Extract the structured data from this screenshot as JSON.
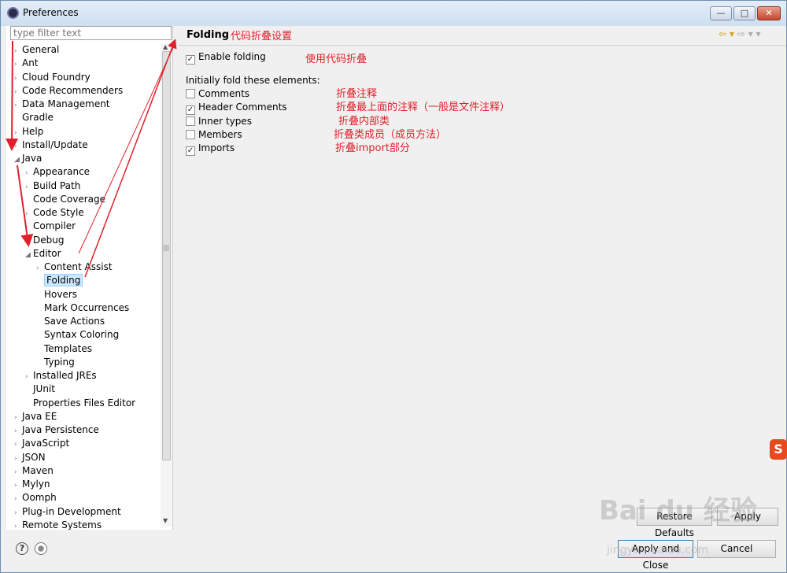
{
  "window": {
    "title": "Preferences",
    "minimize_glyph": "—",
    "maximize_glyph": "□",
    "close_glyph": "✕"
  },
  "filter": {
    "placeholder": "type filter text"
  },
  "tree": [
    {
      "label": "General",
      "level": 0,
      "expander": "›"
    },
    {
      "label": "Ant",
      "level": 0,
      "expander": "›"
    },
    {
      "label": "Cloud Foundry",
      "level": 0,
      "expander": "›"
    },
    {
      "label": "Code Recommenders",
      "level": 0,
      "expander": "›"
    },
    {
      "label": "Data Management",
      "level": 0,
      "expander": "›"
    },
    {
      "label": "Gradle",
      "level": 0,
      "expander": ""
    },
    {
      "label": "Help",
      "level": 0,
      "expander": "›"
    },
    {
      "label": "Install/Update",
      "level": 0,
      "expander": "›"
    },
    {
      "label": "Java",
      "level": 0,
      "expander": "◢"
    },
    {
      "label": "Appearance",
      "level": 1,
      "expander": "›"
    },
    {
      "label": "Build Path",
      "level": 1,
      "expander": "›"
    },
    {
      "label": "Code Coverage",
      "level": 1,
      "expander": ""
    },
    {
      "label": "Code Style",
      "level": 1,
      "expander": "›"
    },
    {
      "label": "Compiler",
      "level": 1,
      "expander": "›"
    },
    {
      "label": "Debug",
      "level": 1,
      "expander": "›"
    },
    {
      "label": "Editor",
      "level": 1,
      "expander": "◢"
    },
    {
      "label": "Content Assist",
      "level": 2,
      "expander": "›"
    },
    {
      "label": "Folding",
      "level": 2,
      "expander": "",
      "selected": true
    },
    {
      "label": "Hovers",
      "level": 2,
      "expander": ""
    },
    {
      "label": "Mark Occurrences",
      "level": 2,
      "expander": ""
    },
    {
      "label": "Save Actions",
      "level": 2,
      "expander": ""
    },
    {
      "label": "Syntax Coloring",
      "level": 2,
      "expander": ""
    },
    {
      "label": "Templates",
      "level": 2,
      "expander": ""
    },
    {
      "label": "Typing",
      "level": 2,
      "expander": ""
    },
    {
      "label": "Installed JREs",
      "level": 1,
      "expander": "›"
    },
    {
      "label": "JUnit",
      "level": 1,
      "expander": ""
    },
    {
      "label": "Properties Files Editor",
      "level": 1,
      "expander": ""
    },
    {
      "label": "Java EE",
      "level": 0,
      "expander": "›"
    },
    {
      "label": "Java Persistence",
      "level": 0,
      "expander": "›"
    },
    {
      "label": "JavaScript",
      "level": 0,
      "expander": "›"
    },
    {
      "label": "JSON",
      "level": 0,
      "expander": "›"
    },
    {
      "label": "Maven",
      "level": 0,
      "expander": "›"
    },
    {
      "label": "Mylyn",
      "level": 0,
      "expander": "›"
    },
    {
      "label": "Oomph",
      "level": 0,
      "expander": "›"
    },
    {
      "label": "Plug-in Development",
      "level": 0,
      "expander": "›"
    },
    {
      "label": "Remote Systems",
      "level": 0,
      "expander": "›"
    }
  ],
  "page": {
    "title": "Folding",
    "title_note": "代码折叠设置",
    "nav_back": "⇦ ▾",
    "nav_forward": "⇨ ▾ ▾",
    "enable": {
      "label": "Enable folding",
      "checked": true,
      "note": "使用代码折叠"
    },
    "section_label": "Initially fold these elements:",
    "elements": [
      {
        "label": "Comments",
        "checked": false,
        "note": "折叠注释"
      },
      {
        "label": "Header Comments",
        "checked": true,
        "note": "折叠最上面的注释（一般是文件注释）"
      },
      {
        "label": "Inner types",
        "checked": false,
        "note": "折叠内部类"
      },
      {
        "label": "Members",
        "checked": false,
        "note": "折叠类成员（成员方法）"
      },
      {
        "label": "Imports",
        "checked": true,
        "note": "折叠import部分"
      }
    ],
    "check_glyph": "✓"
  },
  "buttons": {
    "restore_defaults": "Restore Defaults",
    "apply": "Apply",
    "apply_and_close": "Apply and Close",
    "cancel": "Cancel"
  },
  "footer": {
    "help_glyph": "?"
  },
  "watermark": {
    "main": "Bai du 经验",
    "sub": "jingyan.baidu.com",
    "side_logo": "S"
  },
  "colors": {
    "annotation": "#e0212b",
    "selection": "#cce8ff"
  }
}
